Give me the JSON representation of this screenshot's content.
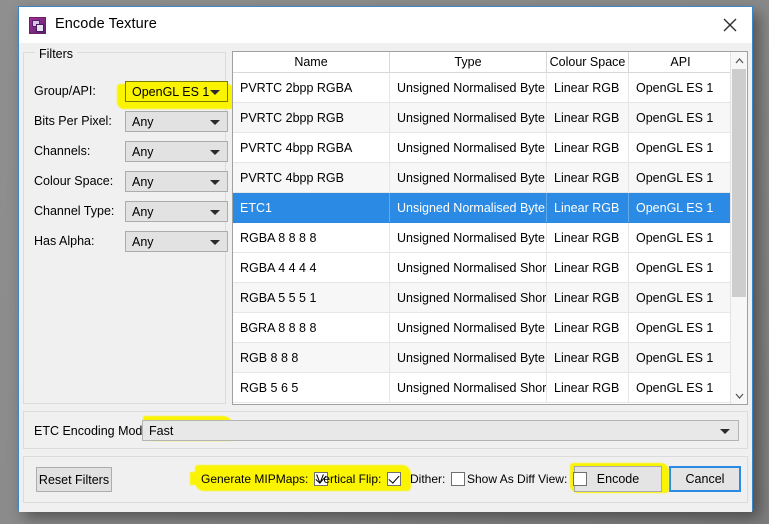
{
  "window": {
    "title": "Encode Texture",
    "icon": "texture-app-icon",
    "close_label": "close-icon"
  },
  "filters": {
    "legend": "Filters",
    "rows": [
      {
        "label": "Group/API:",
        "value": "OpenGL ES 1",
        "highlighted": true
      },
      {
        "label": "Bits Per Pixel:",
        "value": "Any",
        "highlighted": false
      },
      {
        "label": "Channels:",
        "value": "Any",
        "highlighted": false
      },
      {
        "label": "Colour Space:",
        "value": "Any",
        "highlighted": false
      },
      {
        "label": "Channel Type:",
        "value": "Any",
        "highlighted": false
      },
      {
        "label": "Has Alpha:",
        "value": "Any",
        "highlighted": false
      }
    ]
  },
  "table": {
    "columns": [
      "Name",
      "Type",
      "Colour Space",
      "API"
    ],
    "selected_index": 4,
    "rows": [
      {
        "name": "PVRTC 2bpp RGBA",
        "type": "Unsigned Normalised Byte",
        "colour_space": "Linear RGB",
        "api": "OpenGL ES 1"
      },
      {
        "name": "PVRTC 2bpp RGB",
        "type": "Unsigned Normalised Byte",
        "colour_space": "Linear RGB",
        "api": "OpenGL ES 1"
      },
      {
        "name": "PVRTC 4bpp RGBA",
        "type": "Unsigned Normalised Byte",
        "colour_space": "Linear RGB",
        "api": "OpenGL ES 1"
      },
      {
        "name": "PVRTC 4bpp RGB",
        "type": "Unsigned Normalised Byte",
        "colour_space": "Linear RGB",
        "api": "OpenGL ES 1"
      },
      {
        "name": "ETC1",
        "type": "Unsigned Normalised Byte",
        "colour_space": "Linear RGB",
        "api": "OpenGL ES 1"
      },
      {
        "name": "RGBA 8 8 8 8",
        "type": "Unsigned Normalised Byte",
        "colour_space": "Linear RGB",
        "api": "OpenGL ES 1"
      },
      {
        "name": "RGBA 4 4 4 4",
        "type": "Unsigned Normalised Short",
        "colour_space": "Linear RGB",
        "api": "OpenGL ES 1"
      },
      {
        "name": "RGBA 5 5 5 1",
        "type": "Unsigned Normalised Short",
        "colour_space": "Linear RGB",
        "api": "OpenGL ES 1"
      },
      {
        "name": "BGRA 8 8 8 8",
        "type": "Unsigned Normalised Byte",
        "colour_space": "Linear RGB",
        "api": "OpenGL ES 1"
      },
      {
        "name": "RGB 8 8 8",
        "type": "Unsigned Normalised Byte",
        "colour_space": "Linear RGB",
        "api": "OpenGL ES 1"
      },
      {
        "name": "RGB 5 6 5",
        "type": "Unsigned Normalised Short",
        "colour_space": "Linear RGB",
        "api": "OpenGL ES 1"
      }
    ]
  },
  "etc": {
    "label": "ETC Encoding Mode:",
    "value": "Fast",
    "highlighted": true
  },
  "actions": {
    "reset_filters": "Reset Filters",
    "encode": "Encode",
    "cancel": "Cancel",
    "checkboxes": [
      {
        "label": "Generate MIPMaps:",
        "checked": true,
        "highlighted": true
      },
      {
        "label": "Vertical Flip:",
        "checked": true,
        "highlighted": true
      },
      {
        "label": "Dither:",
        "checked": false,
        "highlighted": false
      },
      {
        "label": "Show As Diff View:",
        "checked": false,
        "highlighted": false
      }
    ]
  },
  "colors": {
    "selection_blue": "#2a8ae4",
    "highlighter_yellow": "#fbf400",
    "window_border": "#3b86c6",
    "dialog_bg": "#f0f0f0"
  }
}
